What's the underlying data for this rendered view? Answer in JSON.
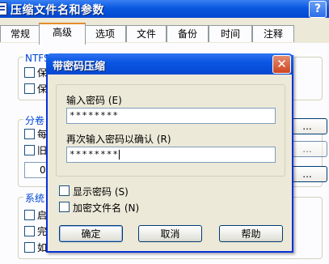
{
  "window": {
    "title": "压缩文件名和参数",
    "help": "?"
  },
  "tabs": [
    {
      "label": "常规"
    },
    {
      "label": "高级"
    },
    {
      "label": "选项"
    },
    {
      "label": "文件"
    },
    {
      "label": "备份"
    },
    {
      "label": "时间"
    },
    {
      "label": "注释"
    }
  ],
  "background": {
    "ntfs_label": "NTFS 选项",
    "ntfs_items": [
      "保",
      "保"
    ],
    "volume_label": "分卷",
    "volume_items": [
      "每",
      "旧"
    ],
    "volume_value": "0",
    "system_label": "系统",
    "system_items": [
      "启",
      "完",
      "如"
    ],
    "ellipsis": "..."
  },
  "dialog": {
    "title": "带密码压缩",
    "close": "✕",
    "enter_label": "输入密码 (E)",
    "enter_value": "********",
    "reenter_label": "再次输入密码以确认 (R)",
    "reenter_value": "********",
    "show_password": "显示密码 (S)",
    "encrypt_names": "加密文件名 (N)",
    "ok": "确定",
    "cancel": "取消",
    "help": "帮助"
  }
}
